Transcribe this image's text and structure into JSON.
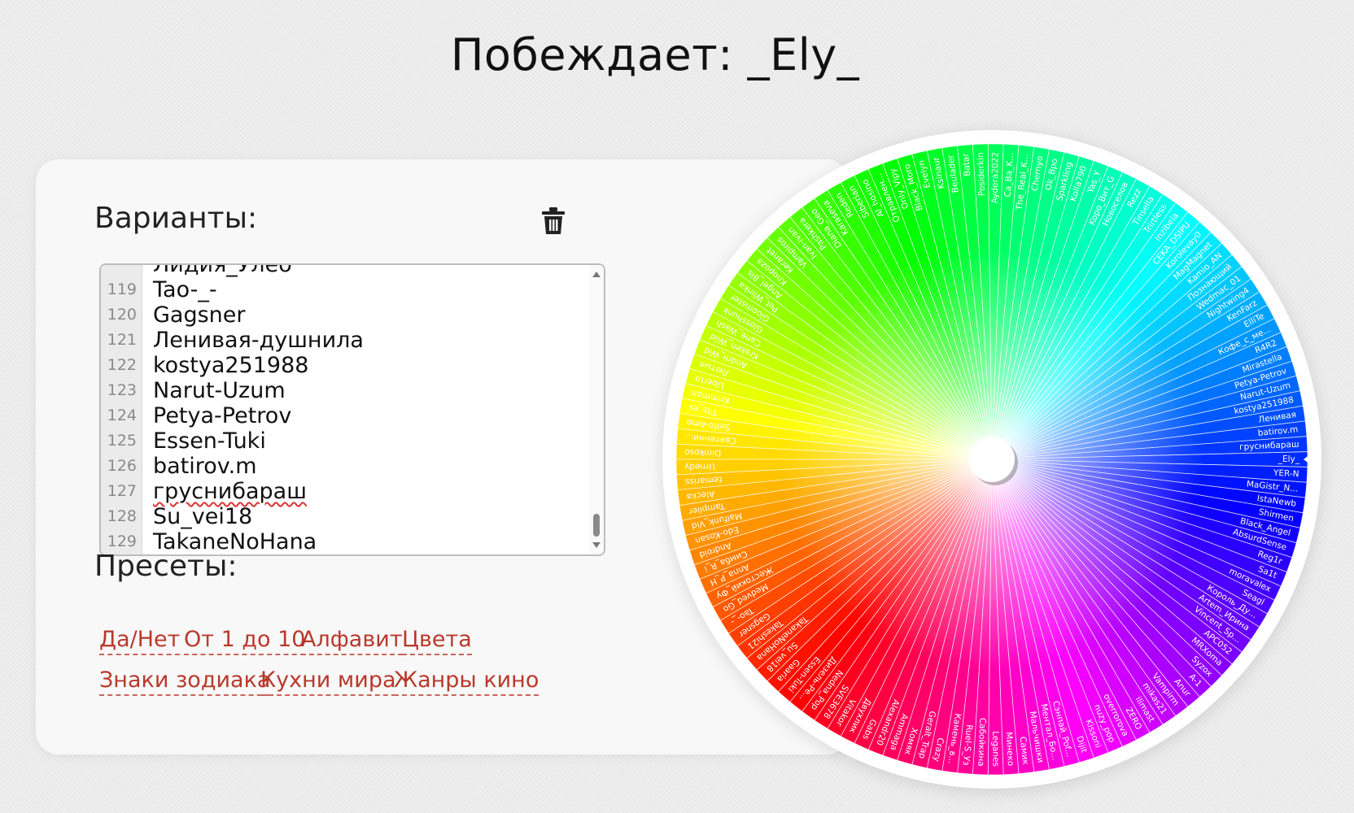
{
  "header": {
    "winner_text": "Побеждает: _Ely_"
  },
  "options_panel": {
    "title": "Варианты:",
    "clear_icon": "trash-icon",
    "partial_top_line": "Лидия_Улеб",
    "lines": [
      {
        "num": "119",
        "text": "Tao-_-"
      },
      {
        "num": "120",
        "text": "Gagsner"
      },
      {
        "num": "121",
        "text": "Ленивая-душнила"
      },
      {
        "num": "122",
        "text": "kostya251988"
      },
      {
        "num": "123",
        "text": "Narut-Uzum"
      },
      {
        "num": "124",
        "text": "Petya-Petrov"
      },
      {
        "num": "125",
        "text": "Essen-Tuki"
      },
      {
        "num": "126",
        "text": "batirov.m"
      },
      {
        "num": "127",
        "text": "груснибараш",
        "spell_error": true
      },
      {
        "num": "128",
        "text": "Su_vei18"
      },
      {
        "num": "129",
        "text": "TakaneNoHana"
      }
    ]
  },
  "presets": {
    "title": "Пресеты:",
    "row1": [
      "Да/Нет",
      "От 1 до 10",
      "Алфавит",
      "Цвета"
    ],
    "row2": [
      "Знаки зодиака",
      "Кухни мира",
      "Жанры кино"
    ]
  },
  "wheel": {
    "segment_count": 129,
    "winner_label": "_Ely_",
    "labels": [
      "_Ely_",
      "YER-N",
      "MaGistr_N...",
      "IstaNewb",
      "Shirmen",
      "Black_Angel",
      "AbsurdSense",
      "Reg1r",
      "Sa1t",
      "moravalex",
      "Seagl",
      "Король_Ду...",
      "Artem_Ирина",
      "Vincent_Sp...",
      "APC052",
      "MRXoma",
      "Syzox",
      "A-1",
      "Anur",
      "Vampirm",
      "mikas21",
      "ilimast",
      "ZERO",
      "overrorova",
      "nuzy_pop",
      "Kissoni",
      "Dijit",
      "Сэнпай_Pof...",
      "Ментал_Бо...",
      "Мальчишки",
      "Самик",
      "Минеко",
      "Leganes",
      "Сабойкина",
      "Ruel-S_Уз",
      "Камень_в...",
      "Crazy",
      "Geralt_Trap",
      "Хомяк",
      "Ammaga",
      "Alexandr20",
      "Gabs",
      "Двухлик",
      "Vitakor",
      "SVE3678",
      "Nedna_Pop",
      "Дизель-Ре...",
      "Essen-Tuki",
      "Gaaria",
      "Su_vei18",
      "TakaneNoHana",
      "Takeshi21",
      "Gagsner",
      "Tao-_-",
      "Medved_Go",
      "Жестокий_Фу",
      "Anna_P_H",
      "Симба_R_i",
      "Android",
      "Edo-Kosan",
      "Malfunk_Vid",
      "Tamplier",
      "Alecka",
      "temariss",
      "Urnedy",
      "Dimkoso",
      "Святенни...",
      "Selfo-Amo",
      "Tits_es",
      "Krimmon",
      "Liberto",
      "Лютые",
      "Andrii_Wid",
      "Kraken_Wild",
      "Cane_Wash",
      "Glosshunk",
      "Gloomster",
      "Pet_Wlinka",
      "Angel_Bis",
      "Knopoza",
      "Keranet",
      "Vampiros",
      "Ivan-ivan",
      "Pashkera",
      "Diana_Geo",
      "Karaseva",
      "Reden",
      "Siberian",
      "Al_hosino",
      "Отравлен...",
      "Only_Vipy",
      "Black_Moro",
      "Evelyn",
      "Ksinaur",
      "Beulader",
      "Batar",
      "Posiderkin",
      "Aydera2022",
      "Ca_Ba_K...",
      "The_Real_K...",
      "Chernyo",
      "Ok_Bpo",
      "Sparkling",
      "Kolla790",
      "Yas_Y",
      "Kopo_Вит_G",
      "Новоселов",
      "Rezz",
      "Tinsella",
      "Trirtless",
      "Inzibela",
      "CEKA_DSIPU",
      "Korolevaу0",
      "MagMagnet",
      "Kamio_AN",
      "Познающий",
      "Wedmac_01",
      "Nightwing4",
      "KenFarz",
      "ElliTe",
      "Кофе_с_ме...",
      "R4R2",
      "Mirastella",
      "Petya-Petrov",
      "Narut-Uzum",
      "kostya251988",
      "Ленивая",
      "batirov.m",
      "груснибараш"
    ]
  }
}
